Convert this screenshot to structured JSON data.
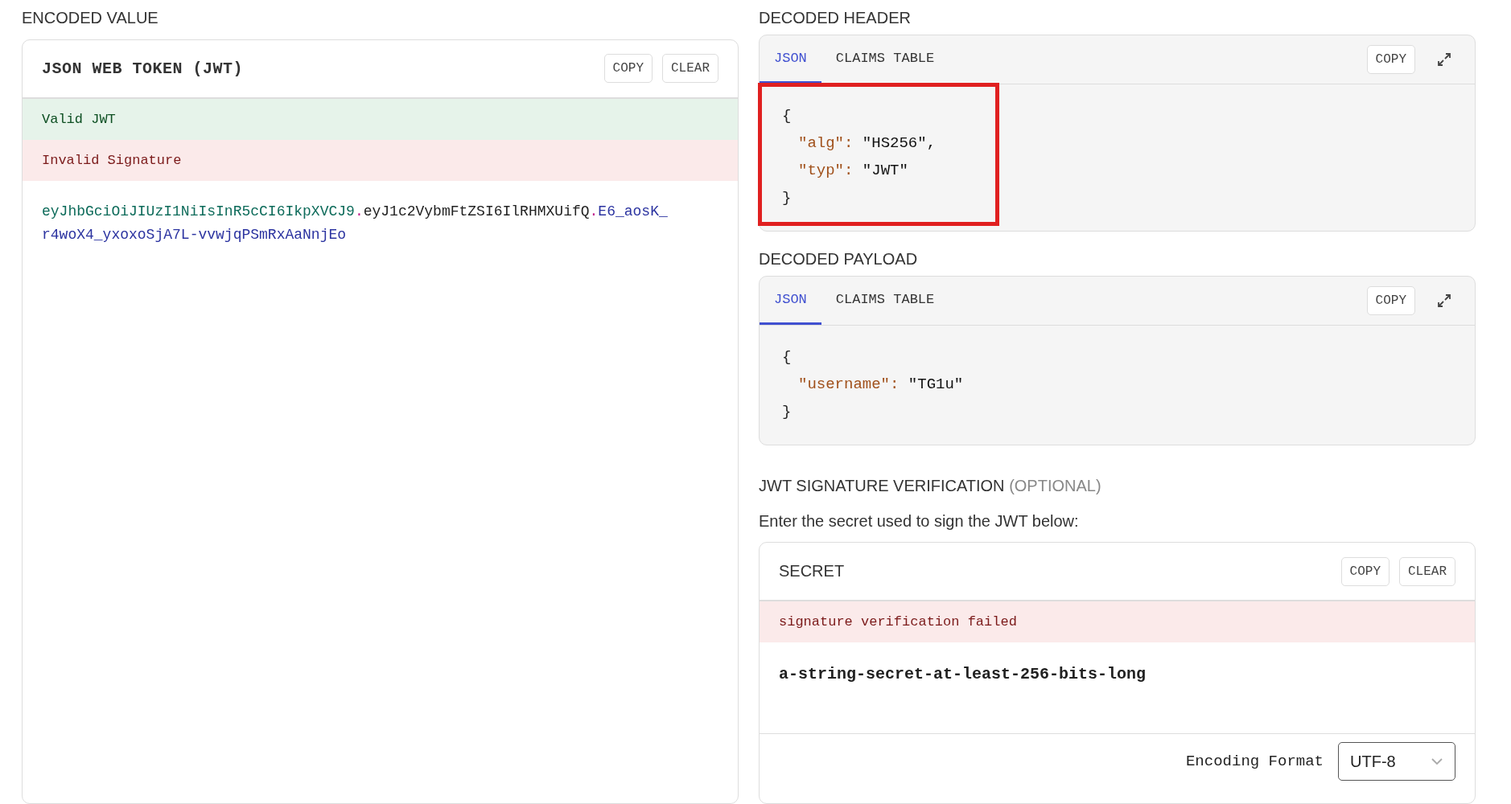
{
  "encoded": {
    "heading": "ENCODED VALUE",
    "card_title": "JSON WEB TOKEN (JWT)",
    "buttons": [
      "COPY",
      "CLEAR"
    ],
    "statuses": [
      {
        "kind": "valid",
        "text": "Valid JWT"
      },
      {
        "kind": "invalid",
        "text": "Invalid Signature"
      }
    ],
    "token_lines": [
      [
        {
          "kind": "header",
          "text": "eyJhbGciOiJIUzI1NiIsInR5cCI6IkpXVCJ9"
        },
        {
          "kind": "dot",
          "text": "."
        },
        {
          "kind": "payload",
          "text": "eyJ1c2VybmFtZSI6IlRHMXUifQ"
        },
        {
          "kind": "dot",
          "text": "."
        },
        {
          "kind": "signature",
          "text": "E6_aosK_"
        }
      ],
      [
        {
          "kind": "signature",
          "text": "r4woX4_yxoxoSjA7L-vvwjqPSmRxAaNnjEo"
        }
      ]
    ]
  },
  "decoded_header": {
    "heading": "DECODED HEADER",
    "highlighted": true,
    "tabs": [
      {
        "label": "JSON",
        "selected": true
      },
      {
        "label": "CLAIMS TABLE",
        "selected": false
      }
    ],
    "copy": "COPY",
    "open": "{",
    "close": "}",
    "entries": [
      {
        "key": "\"alg\"",
        "sep": ":",
        "value": "\"HS256\","
      },
      {
        "key": "\"typ\"",
        "sep": ":",
        "value": "\"JWT\""
      }
    ]
  },
  "decoded_payload": {
    "heading": "DECODED PAYLOAD",
    "tabs": [
      {
        "label": "JSON",
        "selected": true
      },
      {
        "label": "CLAIMS TABLE",
        "selected": false
      }
    ],
    "copy": "COPY",
    "open": "{",
    "close": "}",
    "entries": [
      {
        "key": "\"username\"",
        "sep": ":",
        "value": "\"TG1u\""
      }
    ]
  },
  "verification": {
    "heading": "JWT SIGNATURE VERIFICATION",
    "heading_note": "(OPTIONAL)",
    "instruction": "Enter the secret used to sign the JWT below:",
    "card_title": "SECRET",
    "buttons": [
      "COPY",
      "CLEAR"
    ],
    "error": "signature verification failed",
    "secret": "a-string-secret-at-least-256-bits-long",
    "encoding_label": "Encoding Format",
    "encoding_value": "UTF-8"
  }
}
